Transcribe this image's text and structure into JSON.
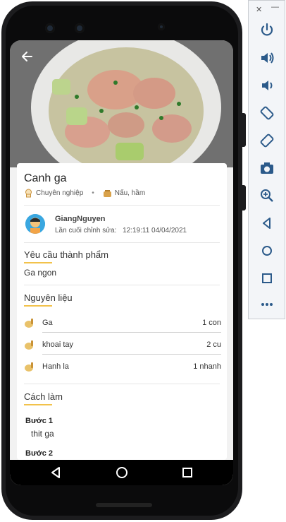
{
  "recipe": {
    "title": "Canh ga",
    "level": "Chuyên nghiệp",
    "method": "Nấu, hầm",
    "author": {
      "name": "GiangNguyen",
      "last_edit_label": "Lần cuối chỉnh sửa:",
      "last_edit_value": "12:19:11 04/04/2021"
    },
    "requirement": {
      "title": "Yêu cầu thành phẩm",
      "text": "Ga ngon"
    },
    "ingredients": {
      "title": "Nguyên liệu",
      "items": [
        {
          "name": "Ga",
          "qty": "1 con"
        },
        {
          "name": "khoai tay",
          "qty": "2 cu"
        },
        {
          "name": "Hanh la",
          "qty": "1 nhanh"
        }
      ]
    },
    "steps": {
      "title": "Cách làm",
      "items": [
        {
          "label": "Bước 1",
          "text": "thit ga"
        },
        {
          "label": "Bước 2",
          "text": ""
        }
      ]
    }
  },
  "emulator_toolbar": {
    "buttons": [
      "power-icon",
      "volume-up-icon",
      "volume-down-icon",
      "rotate-left-icon",
      "rotate-right-icon",
      "camera-icon",
      "zoom-icon",
      "back-icon",
      "home-icon",
      "overview-icon",
      "more-icon"
    ]
  },
  "colors": {
    "accent_underline": "#f2c24b",
    "avatar_bg": "#3aa7e0"
  }
}
